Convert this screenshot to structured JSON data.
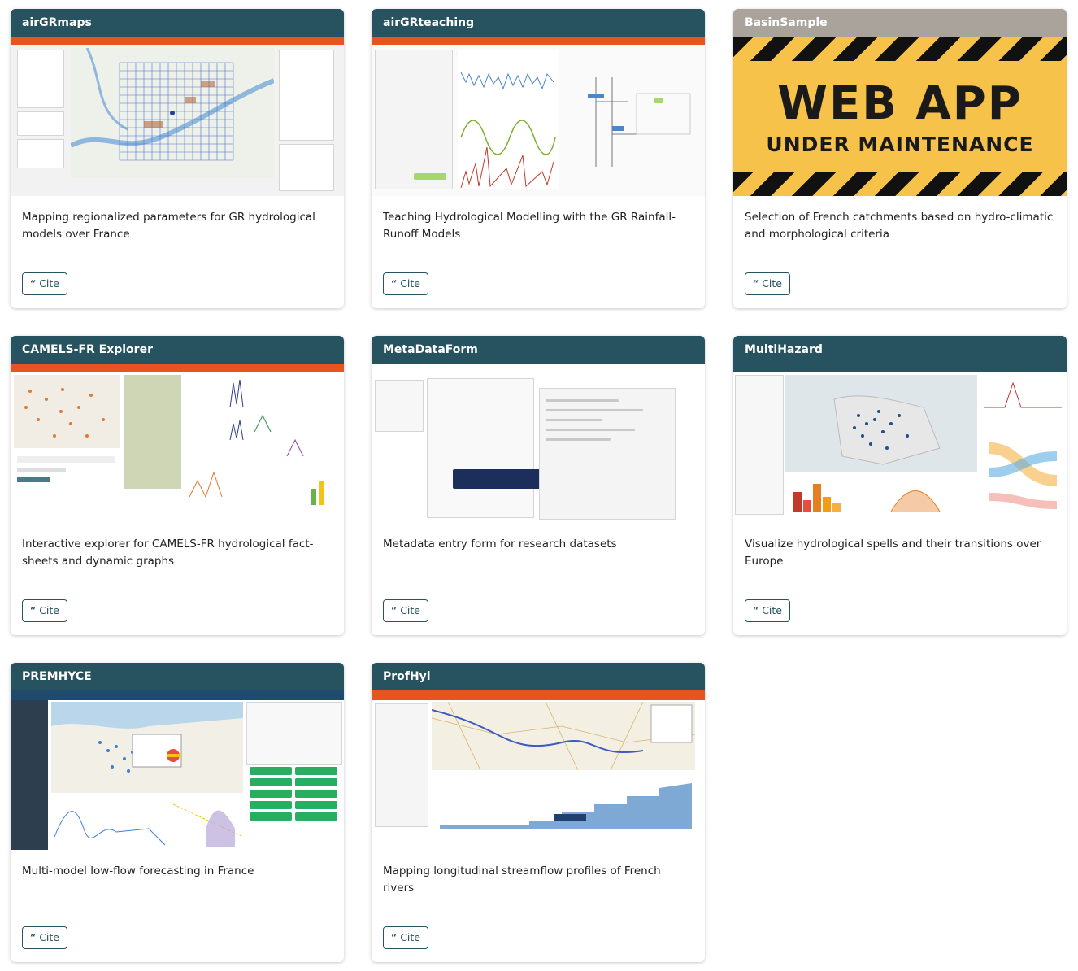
{
  "cards": [
    {
      "title": "airGRmaps",
      "description": "Mapping regionalized parameters for GR hydrological models over France",
      "cite_label": "Cite",
      "thumbnail": "app screenshot"
    },
    {
      "title": "airGRteaching",
      "description": "Teaching Hydrological Modelling with the GR Rainfall-Runoff Models",
      "cite_label": "Cite",
      "thumbnail": "app screenshot"
    },
    {
      "title": "BasinSample",
      "description": "Selection of French catchments based on hydro-climatic and morphological criteria",
      "cite_label": "Cite",
      "thumbnail": "maintenance banner",
      "banner_title": "WEB APP",
      "banner_subtitle": "UNDER MAINTENANCE"
    },
    {
      "title": "CAMELS-FR Explorer",
      "description": "Interactive explorer for CAMELS-FR hydrological fact-sheets and dynamic graphs",
      "cite_label": "Cite",
      "thumbnail": "app screenshot"
    },
    {
      "title": "MetaDataForm",
      "description": "Metadata entry form for research datasets",
      "cite_label": "Cite",
      "thumbnail": "app screenshot"
    },
    {
      "title": "MultiHazard",
      "description": "Visualize hydrological spells and their transitions over Europe",
      "cite_label": "Cite",
      "thumbnail": "app screenshot"
    },
    {
      "title": "PREMHYCE",
      "description": "Multi-model low-flow forecasting in France",
      "cite_label": "Cite",
      "thumbnail": "app screenshot"
    },
    {
      "title": "ProfHyl",
      "description": "Mapping longitudinal streamflow profiles of French rivers",
      "cite_label": "Cite",
      "thumbnail": "app screenshot"
    }
  ],
  "colors": {
    "header": "#26535f",
    "header_muted": "#a9a39c",
    "accent_orange": "#e8531f",
    "maintenance_yellow": "#f6c24a"
  },
  "icons": {
    "cite": "quote-icon"
  }
}
